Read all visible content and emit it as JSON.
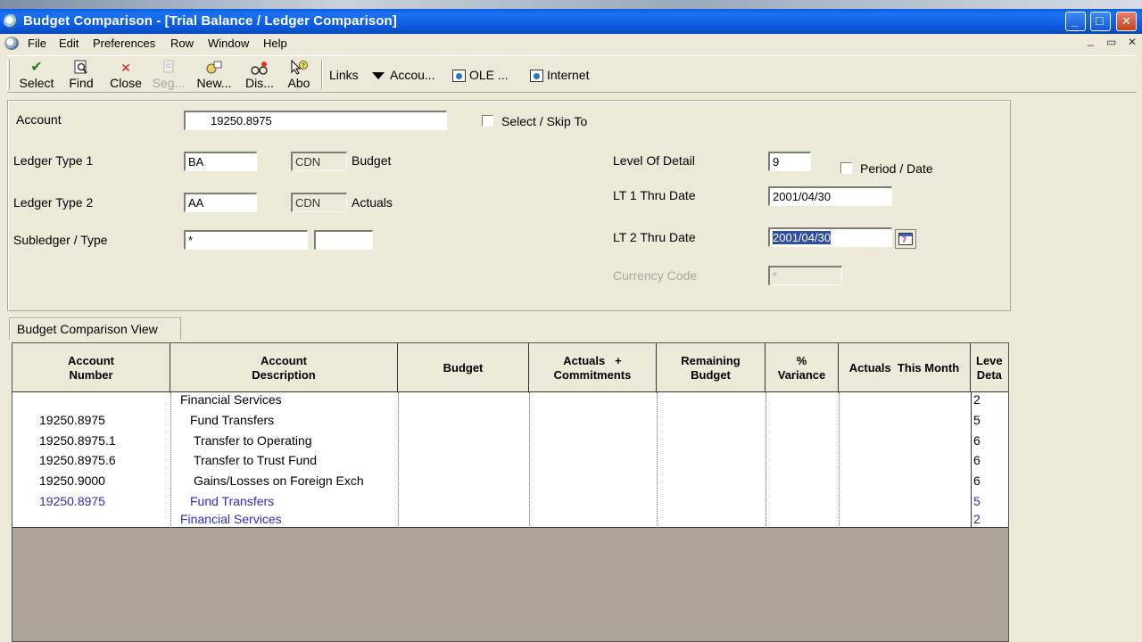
{
  "window": {
    "title": "Budget Comparison - [Trial Balance / Ledger Comparison]",
    "controls": {
      "minimize": "_",
      "maximize": "□",
      "close": "✕"
    }
  },
  "menu": [
    "File",
    "Edit",
    "Preferences",
    "Row",
    "Window",
    "Help"
  ],
  "toolbar": {
    "items": [
      {
        "label": "Select",
        "icon": "check-icon"
      },
      {
        "label": "Find",
        "icon": "find-icon"
      },
      {
        "label": "Close",
        "icon": "close-x-icon"
      },
      {
        "label": "Seg...",
        "icon": "seg-icon"
      },
      {
        "label": "New...",
        "icon": "new-icon"
      },
      {
        "label": "Dis...",
        "icon": "display-icon"
      },
      {
        "label": "Abo",
        "icon": "about-icon"
      }
    ],
    "links_label": "Links",
    "accou_label": "Accou...",
    "ole_label": "OLE ...",
    "internet_label": "Internet"
  },
  "form": {
    "account_label": "Account",
    "account_value": "19250.8975",
    "select_skip_label": "Select / Skip To",
    "ledger1_label": "Ledger Type 1",
    "ledger1_value": "BA",
    "ledger1_currency": "CDN",
    "ledger1_desc": "Budget",
    "ledger2_label": "Ledger Type 2",
    "ledger2_value": "AA",
    "ledger2_currency": "CDN",
    "ledger2_desc": "Actuals",
    "subledger_label": "Subledger / Type",
    "subledger_value": "*",
    "subledger_type_value": "",
    "level_label": "Level Of Detail",
    "level_value": "9",
    "period_date_label": "Period / Date",
    "lt1_label": "LT 1 Thru Date",
    "lt1_value": "2001/04/30",
    "lt2_label": "LT 2 Thru Date",
    "lt2_value": "2001/04/30",
    "currency_label": "Currency Code",
    "currency_value": "*"
  },
  "tab_label": "Budget Comparison View",
  "grid": {
    "headers": [
      "Account\nNumber",
      "Account\nDescription",
      "Budget",
      "Actuals   +\nCommitments",
      "Remaining\nBudget",
      "%\nVariance",
      "Actuals  This Month",
      "Leve\nDeta"
    ],
    "rows": [
      {
        "account": "",
        "description": "Financial Services",
        "level": "2",
        "blue": false
      },
      {
        "account": "19250.8975",
        "description": "Fund Transfers",
        "level": "5",
        "blue": false
      },
      {
        "account": "19250.8975.1",
        "description": "Transfer to Operating",
        "level": "6",
        "blue": false
      },
      {
        "account": "19250.8975.6",
        "description": "Transfer to Trust Fund",
        "level": "6",
        "blue": false
      },
      {
        "account": "19250.9000",
        "description": "Gains/Losses on Foreign Exch",
        "level": "6",
        "blue": false
      },
      {
        "account": "19250.8975",
        "description": "Fund Transfers",
        "level": "5",
        "blue": true
      },
      {
        "account": "",
        "description": "Financial Services",
        "level": "2",
        "blue": true
      }
    ]
  }
}
